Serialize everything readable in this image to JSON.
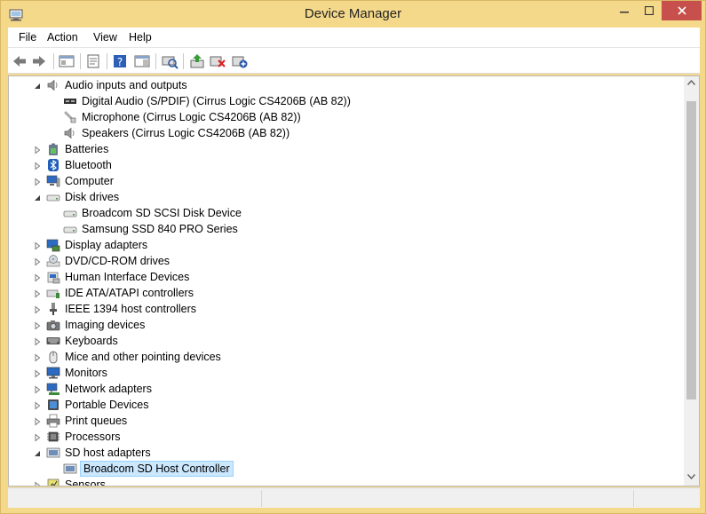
{
  "window": {
    "title": "Device Manager",
    "accent": "#f5d98b",
    "close_color": "#c7504c"
  },
  "menu": [
    {
      "label": "File"
    },
    {
      "label": "Action"
    },
    {
      "label": "View"
    },
    {
      "label": "Help"
    }
  ],
  "toolbar": [
    {
      "name": "back-arrow-icon"
    },
    {
      "name": "forward-arrow-icon"
    },
    {
      "name": "show-hide-console-tree-icon"
    },
    {
      "name": "properties-icon"
    },
    {
      "name": "help-icon"
    },
    {
      "name": "action-pane-icon"
    },
    {
      "name": "scan-hardware-changes-icon"
    },
    {
      "name": "update-driver-icon"
    },
    {
      "name": "uninstall-device-icon"
    },
    {
      "name": "add-legacy-hardware-icon"
    }
  ],
  "tree": [
    {
      "label": "Audio inputs and outputs",
      "level": 0,
      "state": "expanded",
      "icon": "speaker-icon"
    },
    {
      "label": "Digital Audio (S/PDIF) (Cirrus Logic CS4206B (AB 82))",
      "level": 1,
      "icon": "spdif-icon"
    },
    {
      "label": "Microphone (Cirrus Logic CS4206B (AB 82))",
      "level": 1,
      "icon": "microphone-icon"
    },
    {
      "label": "Speakers (Cirrus Logic CS4206B (AB 82))",
      "level": 1,
      "icon": "speaker-icon"
    },
    {
      "label": "Batteries",
      "level": 0,
      "state": "collapsed",
      "icon": "battery-icon"
    },
    {
      "label": "Bluetooth",
      "level": 0,
      "state": "collapsed",
      "icon": "bluetooth-icon"
    },
    {
      "label": "Computer",
      "level": 0,
      "state": "collapsed",
      "icon": "computer-icon"
    },
    {
      "label": "Disk drives",
      "level": 0,
      "state": "expanded",
      "icon": "disk-drive-icon"
    },
    {
      "label": "Broadcom SD SCSI Disk Device",
      "level": 1,
      "icon": "disk-drive-icon"
    },
    {
      "label": "Samsung SSD 840 PRO Series",
      "level": 1,
      "icon": "disk-drive-icon"
    },
    {
      "label": "Display adapters",
      "level": 0,
      "state": "collapsed",
      "icon": "display-adapter-icon"
    },
    {
      "label": "DVD/CD-ROM drives",
      "level": 0,
      "state": "collapsed",
      "icon": "dvd-drive-icon"
    },
    {
      "label": "Human Interface Devices",
      "level": 0,
      "state": "collapsed",
      "icon": "hid-icon"
    },
    {
      "label": "IDE ATA/ATAPI controllers",
      "level": 0,
      "state": "collapsed",
      "icon": "ide-controller-icon"
    },
    {
      "label": "IEEE 1394 host controllers",
      "level": 0,
      "state": "collapsed",
      "icon": "firewire-icon"
    },
    {
      "label": "Imaging devices",
      "level": 0,
      "state": "collapsed",
      "icon": "camera-icon"
    },
    {
      "label": "Keyboards",
      "level": 0,
      "state": "collapsed",
      "icon": "keyboard-icon"
    },
    {
      "label": "Mice and other pointing devices",
      "level": 0,
      "state": "collapsed",
      "icon": "mouse-icon"
    },
    {
      "label": "Monitors",
      "level": 0,
      "state": "collapsed",
      "icon": "monitor-icon"
    },
    {
      "label": "Network adapters",
      "level": 0,
      "state": "collapsed",
      "icon": "network-adapter-icon"
    },
    {
      "label": "Portable Devices",
      "level": 0,
      "state": "collapsed",
      "icon": "portable-device-icon"
    },
    {
      "label": "Print queues",
      "level": 0,
      "state": "collapsed",
      "icon": "printer-icon"
    },
    {
      "label": "Processors",
      "level": 0,
      "state": "collapsed",
      "icon": "processor-icon"
    },
    {
      "label": "SD host adapters",
      "level": 0,
      "state": "expanded",
      "icon": "sd-host-icon"
    },
    {
      "label": "Broadcom SD Host Controller",
      "level": 1,
      "icon": "sd-host-icon",
      "selected": true
    },
    {
      "label": "Sensors",
      "level": 0,
      "state": "collapsed",
      "icon": "sensor-icon"
    }
  ]
}
